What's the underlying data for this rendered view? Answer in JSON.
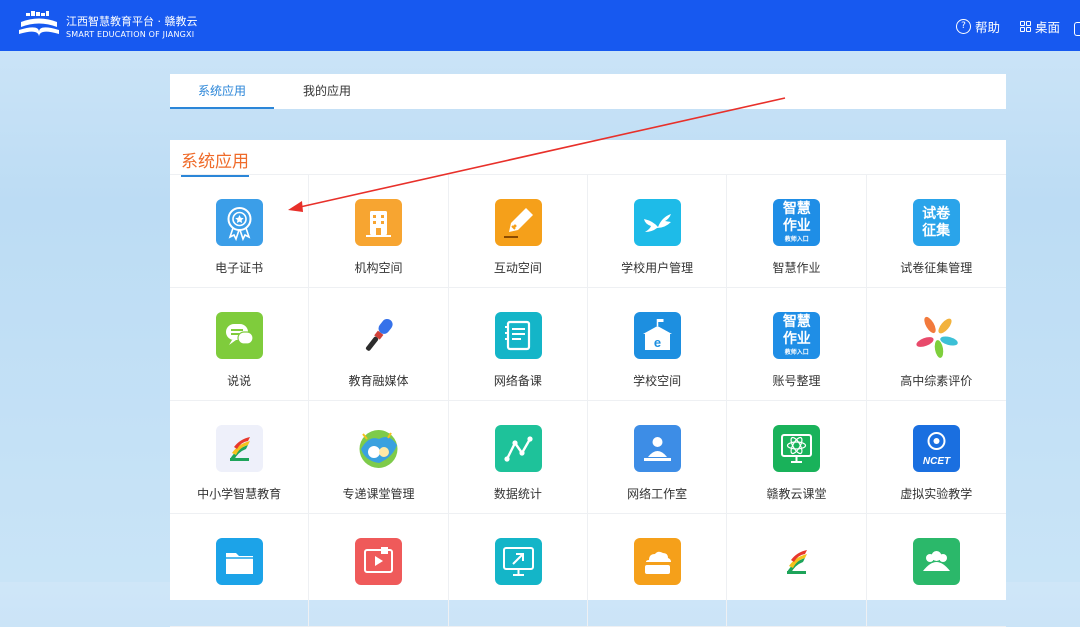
{
  "header": {
    "brand_title": "江西智慧教育平台 · 赣教云",
    "brand_subtitle": "SMART EDUCATION OF JIANGXI",
    "help_label": "帮助",
    "help_glyph": "?",
    "desktop_label": "桌面"
  },
  "tabs": {
    "system_apps": "系统应用",
    "my_apps": "我的应用"
  },
  "section": {
    "title": "系统应用"
  },
  "apps": [
    {
      "label": "电子证书",
      "icon": "certificate-icon",
      "color": "#3b9ee8"
    },
    {
      "label": "机构空间",
      "icon": "building-icon",
      "color": "#f7a531"
    },
    {
      "label": "互动空间",
      "icon": "pen-icon",
      "color": "#f5a01a"
    },
    {
      "label": "学校用户管理",
      "icon": "bird-icon",
      "color": "#1ebbe8"
    },
    {
      "label": "智慧作业",
      "icon": "homework-icon",
      "color": "#1f8ee6",
      "icon_text": "智慧作业",
      "icon_caption": "教师入口"
    },
    {
      "label": "试卷征集管理",
      "icon": "exam-collect-icon",
      "color": "#2aa4ea",
      "icon_text": "试卷征集"
    },
    {
      "label": "说说",
      "icon": "chat-icon",
      "color": "#7fcc3c"
    },
    {
      "label": "教育融媒体",
      "icon": "microphone-icon",
      "color": "#ffffff"
    },
    {
      "label": "网络备课",
      "icon": "notebook-icon",
      "color": "#14b5c8"
    },
    {
      "label": "学校空间",
      "icon": "school-icon",
      "color": "#1d8fe0"
    },
    {
      "label": "账号整理",
      "icon": "account-icon",
      "color": "#1f8ee6",
      "icon_text": "智慧作业",
      "icon_caption": "教师入口"
    },
    {
      "label": "高中综素评价",
      "icon": "pinwheel-icon",
      "color": "#ffffff"
    },
    {
      "label": "中小学智慧教育",
      "icon": "smart-edu-icon",
      "color": "#eef0fa"
    },
    {
      "label": "专递课堂管理",
      "icon": "classroom-icon",
      "color": "#ffffff"
    },
    {
      "label": "数据统计",
      "icon": "statistics-icon",
      "color": "#1ec29a"
    },
    {
      "label": "网络工作室",
      "icon": "studio-icon",
      "color": "#3d8de6"
    },
    {
      "label": "赣教云课堂",
      "icon": "monitor-atom-icon",
      "color": "#19b25a"
    },
    {
      "label": "虚拟实验教学",
      "icon": "ncet-icon",
      "color": "#1a6fe0",
      "icon_text": "NCET"
    },
    {
      "label": "",
      "icon": "folder-icon",
      "color": "#1ca3e8"
    },
    {
      "label": "",
      "icon": "media-icon",
      "color": "#ef5a5a"
    },
    {
      "label": "",
      "icon": "screen-share-icon",
      "color": "#14b5c8"
    },
    {
      "label": "",
      "icon": "cloud-drive-icon",
      "color": "#f5a01a"
    },
    {
      "label": "",
      "icon": "smart-edu-icon",
      "color": "#ffffff"
    },
    {
      "label": "",
      "icon": "group-icon",
      "color": "#2bb86a"
    }
  ]
}
